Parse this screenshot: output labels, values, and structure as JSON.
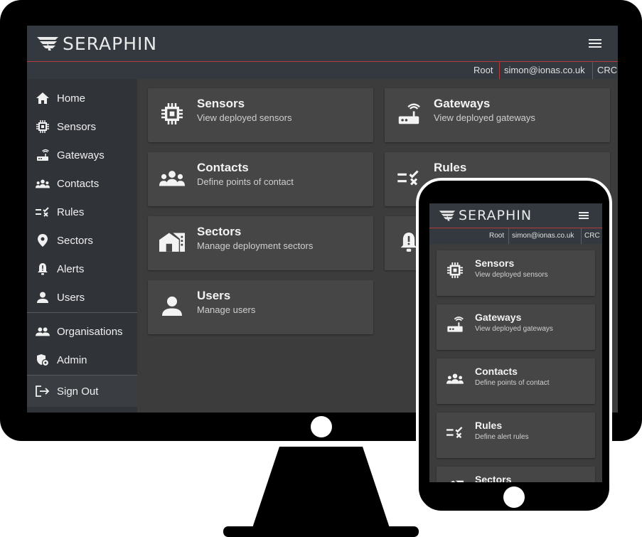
{
  "brand": {
    "name": "SERAPHIN"
  },
  "userbar": {
    "role": "Root",
    "email": "simon@ionas.co.uk",
    "org": "CRC"
  },
  "sidebar": {
    "items": [
      {
        "label": "Home",
        "icon": "home-icon"
      },
      {
        "label": "Sensors",
        "icon": "chip-icon"
      },
      {
        "label": "Gateways",
        "icon": "router-icon"
      },
      {
        "label": "Contacts",
        "icon": "people-icon"
      },
      {
        "label": "Rules",
        "icon": "rules-icon"
      },
      {
        "label": "Sectors",
        "icon": "location-pin-icon"
      },
      {
        "label": "Alerts",
        "icon": "alarm-bell-icon"
      },
      {
        "label": "Users",
        "icon": "user-icon"
      }
    ],
    "admin_items": [
      {
        "label": "Organisations",
        "icon": "group-icon"
      },
      {
        "label": "Admin",
        "icon": "admin-shield-icon"
      }
    ],
    "signout": {
      "label": "Sign Out",
      "icon": "sign-out-icon"
    }
  },
  "cards": [
    {
      "title": "Sensors",
      "subtitle": "View deployed sensors",
      "icon": "chip-icon"
    },
    {
      "title": "Gateways",
      "subtitle": "View deployed gateways",
      "icon": "router-icon"
    },
    {
      "title": "Contacts",
      "subtitle": "Define points of contact",
      "icon": "people-icon"
    },
    {
      "title": "Rules",
      "subtitle": "",
      "icon": "rules-icon"
    },
    {
      "title": "Sectors",
      "subtitle": "Manage deployment sectors",
      "icon": "sectors-icon"
    },
    {
      "title": "",
      "subtitle": "",
      "icon": "alarm-bell-icon"
    },
    {
      "title": "Users",
      "subtitle": "Manage users",
      "icon": "user-icon"
    }
  ],
  "mobile_cards": [
    {
      "title": "Sensors",
      "subtitle": "View deployed sensors",
      "icon": "chip-icon"
    },
    {
      "title": "Gateways",
      "subtitle": "View deployed gateways",
      "icon": "router-icon"
    },
    {
      "title": "Contacts",
      "subtitle": "Define points of contact",
      "icon": "people-icon"
    },
    {
      "title": "Rules",
      "subtitle": "Define alert rules",
      "icon": "rules-icon"
    },
    {
      "title": "Sectors",
      "subtitle": "",
      "icon": "sectors-icon"
    }
  ],
  "colors": {
    "accent": "#b43c3c",
    "header": "#33393f",
    "sidebar": "#303338",
    "card": "#464646",
    "content": "#3c3c3c"
  }
}
